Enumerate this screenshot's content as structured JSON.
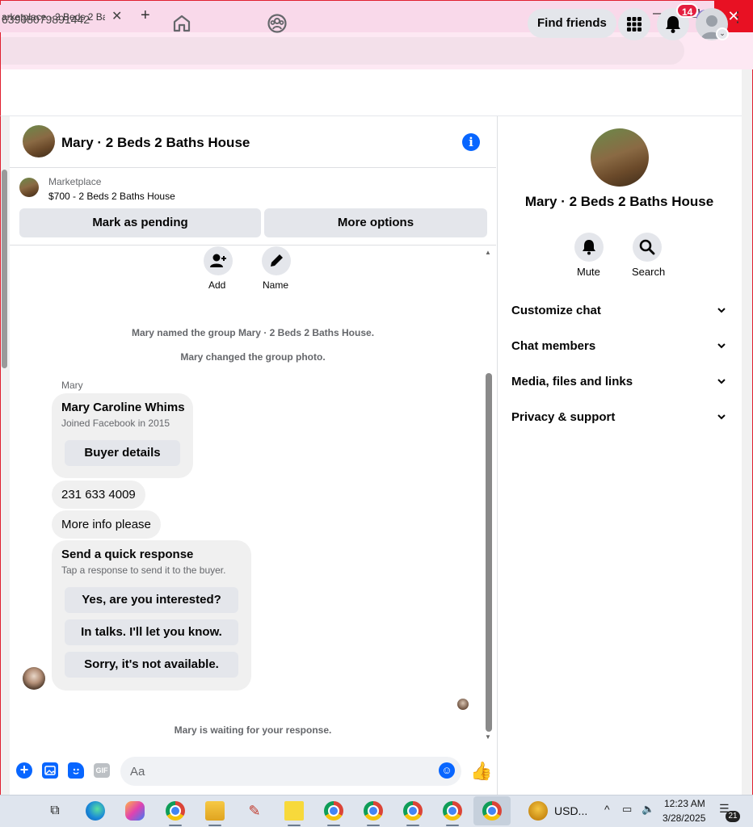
{
  "browser": {
    "tab_title": "arketplace - 2 Beds 2 Bat",
    "tab_close": "✕",
    "new_tab": "+",
    "url": "63908079891442",
    "window_min": "—",
    "window_restore": "❐",
    "window_close": "✕"
  },
  "fb_nav": {
    "find_friends": "Find friends",
    "notification_count": "14",
    "icons": [
      "home-icon",
      "groups-icon",
      "apps-grid-icon",
      "bell-icon",
      "account-icon"
    ]
  },
  "chat": {
    "title": "Mary · 2 Beds 2 Baths House",
    "marketplace_label": "Marketplace",
    "listing": "$700 - 2 Beds 2 Baths House",
    "mark_pending": "Mark as pending",
    "more_options": "More options",
    "add_label": "Add",
    "name_label": "Name",
    "system_messages": [
      "Mary named the group Mary · 2 Beds 2 Baths House.",
      "Mary changed the group photo."
    ],
    "sender": "Mary",
    "profile_card": {
      "name": "Mary Caroline Whims",
      "joined": "Joined Facebook in 2015",
      "button": "Buyer details"
    },
    "messages": [
      "231 633 4009",
      "More info please"
    ],
    "quick_response": {
      "title": "Send a quick response",
      "subtitle": "Tap a response to send it to the buyer.",
      "options": [
        "Yes, are you interested?",
        "In talks. I'll let you know.",
        "Sorry, it's not available."
      ]
    },
    "waiting": "Mary is waiting for your response.",
    "composer": {
      "placeholder": "Aa",
      "gif_label": "GIF"
    }
  },
  "panel": {
    "title": "Mary · 2 Beds 2 Baths House",
    "mute": "Mute",
    "search": "Search",
    "rows": [
      "Customize chat",
      "Chat members",
      "Media, files and links",
      "Privacy & support"
    ]
  },
  "taskbar": {
    "usd": "USD...",
    "time": "12:23 AM",
    "date": "3/28/2025",
    "notifications": "21"
  },
  "colors": {
    "fb_blue": "#0866ff",
    "badge_red": "#e41e3f",
    "tab_pink": "#f9d9ea",
    "close_red": "#e81123"
  }
}
